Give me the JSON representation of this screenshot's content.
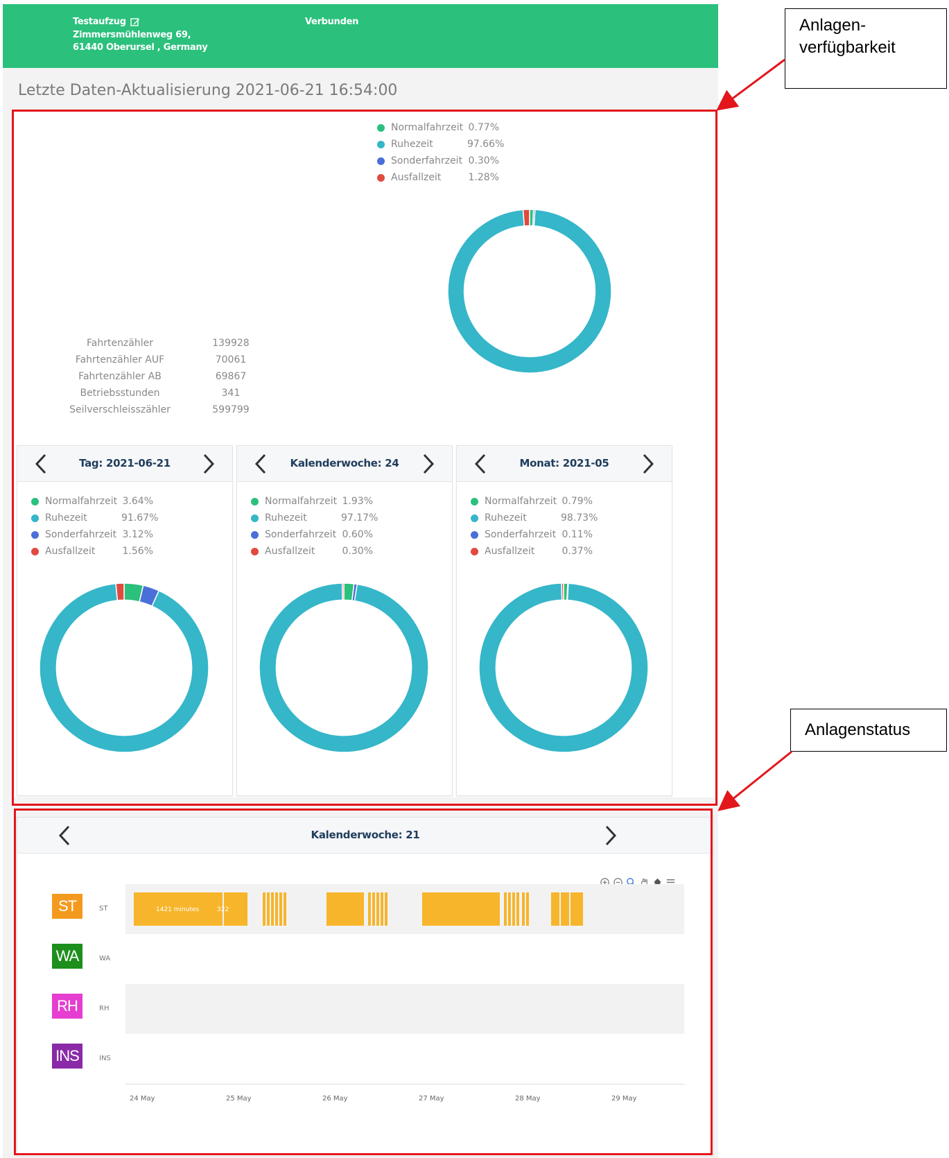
{
  "header": {
    "name": "Testaufzug",
    "address_line1": "Zimmersmühlenweg 69,",
    "address_line2": "61440 Oberursel , Germany",
    "connection_status": "Verbunden"
  },
  "last_update": "Letzte Daten-Aktualisierung 2021-06-21 16:54:00",
  "colors": {
    "header": "#2bc07c",
    "normalfahrzeit": "#2bc07c",
    "ruhezeit": "#35b6c9",
    "sonderfahrzeit": "#4a6fd8",
    "ausfallzeit": "#e04a3f",
    "status_bar": "#f7b52c",
    "annotation_box": "#e3161c"
  },
  "overall": {
    "legend": [
      {
        "label": "Normalfahrzeit",
        "value": "0.77%"
      },
      {
        "label": "Ruhezeit",
        "value": "97.66%"
      },
      {
        "label": "Sonderfahrzeit",
        "value": "0.30%"
      },
      {
        "label": "Ausfallzeit",
        "value": "1.28%"
      }
    ]
  },
  "counters": [
    {
      "label": "Fahrtenzähler",
      "value": "139928"
    },
    {
      "label": "Fahrtenzähler AUF",
      "value": "70061"
    },
    {
      "label": "Fahrtenzähler AB",
      "value": "69867"
    },
    {
      "label": "Betriebsstunden",
      "value": "341"
    },
    {
      "label": "Seilverschleisszähler",
      "value": "599799"
    }
  ],
  "cards": [
    {
      "title": "Tag: 2021-06-21",
      "legend": [
        {
          "label": "Normalfahrzeit",
          "value": "3.64%"
        },
        {
          "label": "Ruhezeit",
          "value": "91.67%"
        },
        {
          "label": "Sonderfahrzeit",
          "value": "3.12%"
        },
        {
          "label": "Ausfallzeit",
          "value": "1.56%"
        }
      ]
    },
    {
      "title": "Kalenderwoche: 24",
      "legend": [
        {
          "label": "Normalfahrzeit",
          "value": "1.93%"
        },
        {
          "label": "Ruhezeit",
          "value": "97.17%"
        },
        {
          "label": "Sonderfahrzeit",
          "value": "0.60%"
        },
        {
          "label": "Ausfallzeit",
          "value": "0.30%"
        }
      ]
    },
    {
      "title": "Monat: 2021-05",
      "legend": [
        {
          "label": "Normalfahrzeit",
          "value": "0.79%"
        },
        {
          "label": "Ruhezeit",
          "value": "98.73%"
        },
        {
          "label": "Sonderfahrzeit",
          "value": "0.11%"
        },
        {
          "label": "Ausfallzeit",
          "value": "0.37%"
        }
      ]
    }
  ],
  "chart_data": [
    {
      "type": "pie",
      "categories": [
        "Normalfahrzeit",
        "Ruhezeit",
        "Sonderfahrzeit",
        "Ausfallzeit"
      ],
      "values": [
        0.77,
        97.66,
        0.3,
        1.28
      ]
    },
    {
      "type": "pie",
      "categories": [
        "Normalfahrzeit",
        "Ruhezeit",
        "Sonderfahrzeit",
        "Ausfallzeit"
      ],
      "values": [
        3.64,
        91.67,
        3.12,
        1.56
      ]
    },
    {
      "type": "pie",
      "categories": [
        "Normalfahrzeit",
        "Ruhezeit",
        "Sonderfahrzeit",
        "Ausfallzeit"
      ],
      "values": [
        1.93,
        97.17,
        0.6,
        0.3
      ]
    },
    {
      "type": "pie",
      "categories": [
        "Normalfahrzeit",
        "Ruhezeit",
        "Sonderfahrzeit",
        "Ausfallzeit"
      ],
      "values": [
        0.79,
        98.73,
        0.11,
        0.37
      ]
    }
  ],
  "status": {
    "title": "Kalenderwoche: 21",
    "lanes": [
      {
        "badge": "ST",
        "label": "ST",
        "color": "#f39a1e"
      },
      {
        "badge": "WA",
        "label": "WA",
        "color": "#1c8f1c"
      },
      {
        "badge": "RH",
        "label": "RH",
        "color": "#e53ed0"
      },
      {
        "badge": "INS",
        "label": "INS",
        "color": "#8a2aa8"
      }
    ],
    "bar_label_1": "1421 minutes",
    "bar_label_2": "322",
    "x_ticks": [
      "24 May",
      "25 May",
      "26 May",
      "27 May",
      "28 May",
      "29 May"
    ]
  },
  "annotations": {
    "availability_line1": "Anlagen-",
    "availability_line2": "verfügbarkeit",
    "status": "Anlagenstatus"
  }
}
